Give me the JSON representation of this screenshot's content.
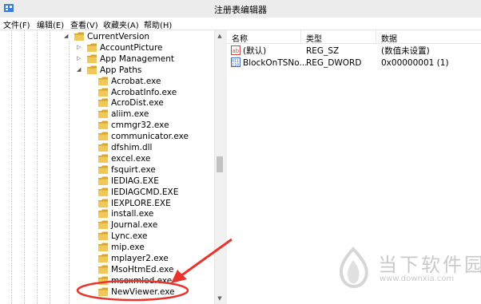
{
  "window": {
    "title": "注册表编辑器"
  },
  "menu": [
    "文件(F)",
    "编辑(E)",
    "查看(V)",
    "收藏夹(A)",
    "帮助(H)"
  ],
  "tree": {
    "items": [
      {
        "label": "CurrentVersion",
        "expander": "expanded"
      },
      {
        "label": "AccountPicture",
        "expander": "collapsed"
      },
      {
        "label": "App Management",
        "expander": "collapsed"
      },
      {
        "label": "App Paths",
        "expander": "expanded"
      },
      {
        "label": "Acrobat.exe"
      },
      {
        "label": "AcrobatInfo.exe"
      },
      {
        "label": "AcroDist.exe"
      },
      {
        "label": "aliim.exe"
      },
      {
        "label": "cmmgr32.exe"
      },
      {
        "label": "communicator.exe"
      },
      {
        "label": "dfshim.dll"
      },
      {
        "label": "excel.exe"
      },
      {
        "label": "fsquirt.exe"
      },
      {
        "label": "IEDIAG.EXE"
      },
      {
        "label": "IEDIAGCMD.EXE"
      },
      {
        "label": "IEXPLORE.EXE"
      },
      {
        "label": "install.exe"
      },
      {
        "label": "Journal.exe"
      },
      {
        "label": "Lync.exe"
      },
      {
        "label": "mip.exe"
      },
      {
        "label": "mplayer2.exe"
      },
      {
        "label": "MsoHtmEd.exe"
      },
      {
        "label": "msoxmled.exe"
      },
      {
        "label": "NewViewer.exe"
      }
    ]
  },
  "values": {
    "columns": [
      "名称",
      "类型",
      "数据"
    ],
    "rows": [
      {
        "name": "(默认)",
        "type": "REG_SZ",
        "data": "(数值未设置)",
        "icon": "string-value-icon"
      },
      {
        "name": "BlockOnTSNo...",
        "type": "REG_DWORD",
        "data": "0x00000001 (1)",
        "icon": "dword-value-icon"
      }
    ]
  },
  "annotation": {
    "highlighted_item": "NewViewer.exe",
    "color": "#e8342c"
  },
  "watermark": {
    "name": "当下软件园",
    "url": "www.downxia.com"
  },
  "colors": {
    "folder": "#f0c85a",
    "folder_dark": "#d9a531",
    "accent_red": "#e8342c"
  }
}
